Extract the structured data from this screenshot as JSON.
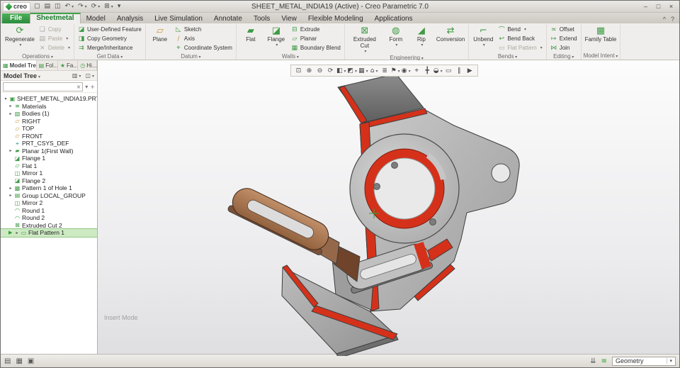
{
  "window": {
    "title": "SHEET_METAL_INDIA19 (Active) - Creo Parametric 7.0",
    "logo_text": "creo",
    "minimize": "–",
    "restore": "□",
    "close": "×",
    "ribbon_toggle": "^",
    "help": "?"
  },
  "qat": {
    "items": [
      {
        "name": "new",
        "glyph": "▢"
      },
      {
        "name": "open",
        "glyph": "▤"
      },
      {
        "name": "save",
        "glyph": "◫"
      },
      {
        "name": "undo",
        "glyph": "↶"
      },
      {
        "name": "redo",
        "glyph": "↷"
      },
      {
        "name": "regenerate",
        "glyph": "⟳"
      },
      {
        "name": "window",
        "glyph": "⊞"
      }
    ],
    "customize_glyph": "▾"
  },
  "tabs": {
    "items": [
      "File",
      "Sheetmetal",
      "Model",
      "Analysis",
      "Live Simulation",
      "Annotate",
      "Tools",
      "View",
      "Flexible Modeling",
      "Applications"
    ],
    "active": "Sheetmetal"
  },
  "ribbon": {
    "groups": [
      {
        "label": "Operations",
        "buttons": [
          {
            "label": "Regenerate",
            "glyph": "⟳"
          },
          {
            "label": "Copy",
            "glyph": "❏"
          },
          {
            "label": "Paste",
            "glyph": "▤"
          },
          {
            "label": "Delete",
            "glyph": "×"
          }
        ]
      },
      {
        "label": "Get Data",
        "buttons": [
          {
            "label": "User-Defined Feature",
            "glyph": "◪"
          },
          {
            "label": "Copy Geometry",
            "glyph": "◨"
          },
          {
            "label": "Merge/Inheritance",
            "glyph": "⇉"
          }
        ]
      },
      {
        "label": "Datum",
        "buttons": [
          {
            "label": "Plane",
            "glyph": "▱"
          },
          {
            "label": "Sketch",
            "glyph": "◺"
          },
          {
            "label": "Axis",
            "glyph": "∕"
          },
          {
            "label": "Coordinate System",
            "glyph": "⌖"
          }
        ]
      },
      {
        "label": "Walls",
        "buttons": [
          {
            "label": "Flat",
            "glyph": "▰"
          },
          {
            "label": "Flange",
            "glyph": "◪"
          },
          {
            "label": "Extrude",
            "glyph": "⊟"
          },
          {
            "label": "Planar",
            "glyph": "▱"
          },
          {
            "label": "Boundary Blend",
            "glyph": "▦"
          }
        ]
      },
      {
        "label": "Engineering",
        "buttons": [
          {
            "label": "Extruded Cut",
            "glyph": "⊠"
          },
          {
            "label": "Form",
            "glyph": "◍"
          },
          {
            "label": "Rip",
            "glyph": "◢"
          },
          {
            "label": "Conversion",
            "glyph": "⇄"
          }
        ]
      },
      {
        "label": "Bends",
        "buttons": [
          {
            "label": "Unbend",
            "glyph": "⌐"
          },
          {
            "label": "Bend",
            "glyph": "⌒"
          },
          {
            "label": "Bend Back",
            "glyph": "↩"
          },
          {
            "label": "Flat Pattern",
            "glyph": "▭"
          }
        ]
      },
      {
        "label": "Editing",
        "buttons": [
          {
            "label": "Offset",
            "glyph": "≍"
          },
          {
            "label": "Extend",
            "glyph": "↦"
          },
          {
            "label": "Join",
            "glyph": "⋈"
          }
        ]
      },
      {
        "label": "Model Intent",
        "buttons": [
          {
            "label": "Family Table",
            "glyph": "▦"
          }
        ]
      }
    ]
  },
  "gfx_toolbar": {
    "items": [
      {
        "name": "refit",
        "glyph": "⊡"
      },
      {
        "name": "zoom-in",
        "glyph": "⊕"
      },
      {
        "name": "zoom-out",
        "glyph": "⊖"
      },
      {
        "name": "repaint",
        "glyph": "⟳"
      },
      {
        "name": "shading-style",
        "glyph": "◧"
      },
      {
        "name": "display-style",
        "glyph": "◩"
      },
      {
        "name": "appearance-gallery",
        "glyph": "▦"
      },
      {
        "name": "saved-orientations",
        "glyph": "⌂"
      },
      {
        "name": "view-manager",
        "glyph": "≣"
      },
      {
        "name": "annotation-display",
        "glyph": "⚑"
      },
      {
        "name": "show-hide",
        "glyph": "◉"
      },
      {
        "name": "spin-center",
        "glyph": "⌖"
      },
      {
        "name": "3d-dragger",
        "glyph": "╋"
      },
      {
        "name": "section",
        "glyph": "◒"
      },
      {
        "name": "zoom-window",
        "glyph": "▭"
      },
      {
        "name": "pause",
        "glyph": "‖"
      },
      {
        "name": "play",
        "glyph": "▶"
      }
    ]
  },
  "model_tree": {
    "nav_tabs": [
      "Model Tree",
      "Fol...",
      "Fa...",
      "Hi..."
    ],
    "title": "Model Tree",
    "header_icons": [
      {
        "name": "view-options",
        "glyph": "▥"
      },
      {
        "name": "show-columns",
        "glyph": "◫"
      }
    ],
    "filter": {
      "value": "",
      "clear_glyph": "×",
      "menu_glyph": "▾",
      "add_glyph": "+"
    },
    "items": [
      {
        "label": "SHEET_METAL_INDIA19.PRT",
        "icon": "part-icon",
        "glyph": "▣",
        "expand": false
      },
      {
        "label": "Materials",
        "icon": "materials-icon",
        "glyph": "≡",
        "expand": true
      },
      {
        "label": "Bodies (1)",
        "icon": "bodies-icon",
        "glyph": "▧",
        "expand": true
      },
      {
        "label": "RIGHT",
        "icon": "datum-plane-icon",
        "glyph": "▱",
        "expand": false
      },
      {
        "label": "TOP",
        "icon": "datum-plane-icon",
        "glyph": "▱",
        "expand": false
      },
      {
        "label": "FRONT",
        "icon": "datum-plane-icon",
        "glyph": "▱",
        "expand": false
      },
      {
        "label": "PRT_CSYS_DEF",
        "icon": "csys-icon",
        "glyph": "⌖",
        "expand": false
      },
      {
        "label": "Planar 1(First Wall)",
        "icon": "wall-icon",
        "glyph": "▰",
        "expand": true
      },
      {
        "label": "Flange 1",
        "icon": "flange-icon",
        "glyph": "◪",
        "expand": false
      },
      {
        "label": "Flat 1",
        "icon": "flat-wall-icon",
        "glyph": "▱",
        "expand": false
      },
      {
        "label": "Mirror 1",
        "icon": "mirror-icon",
        "glyph": "◫",
        "expand": false
      },
      {
        "label": "Flange 2",
        "icon": "flange-icon",
        "glyph": "◪",
        "expand": false
      },
      {
        "label": "Pattern 1 of Hole 1",
        "icon": "pattern-icon",
        "glyph": "▩",
        "expand": true
      },
      {
        "label": "Group LOCAL_GROUP",
        "icon": "group-icon",
        "glyph": "▤",
        "expand": true
      },
      {
        "label": "Mirror 2",
        "icon": "mirror-icon",
        "glyph": "◫",
        "expand": false
      },
      {
        "label": "Round 1",
        "icon": "round-icon",
        "glyph": "◠",
        "expand": false
      },
      {
        "label": "Round 2",
        "icon": "round-icon",
        "glyph": "◠",
        "expand": false
      },
      {
        "label": "Extruded Cut 2",
        "icon": "cut-icon",
        "glyph": "⊠",
        "expand": false
      },
      {
        "label": "Flat Pattern 1",
        "icon": "flat-pattern-icon",
        "glyph": "▭",
        "expand": true,
        "selected": true
      }
    ]
  },
  "viewport": {
    "insert_mode_label": "Insert Mode"
  },
  "status_bar": {
    "selection_filter": "Geometry",
    "icons": [
      {
        "name": "clipboard",
        "glyph": "▤"
      },
      {
        "name": "model",
        "glyph": "▦"
      },
      {
        "name": "views",
        "glyph": "▣"
      },
      {
        "name": "search-results",
        "glyph": "⇊"
      },
      {
        "name": "smart-select",
        "glyph": "≡"
      }
    ]
  },
  "colors": {
    "highlight_red": "#d5311a",
    "strap_tan": "#b5835f",
    "accent_green": "#2fa02f",
    "metal_gray": "#b9b9b9"
  }
}
